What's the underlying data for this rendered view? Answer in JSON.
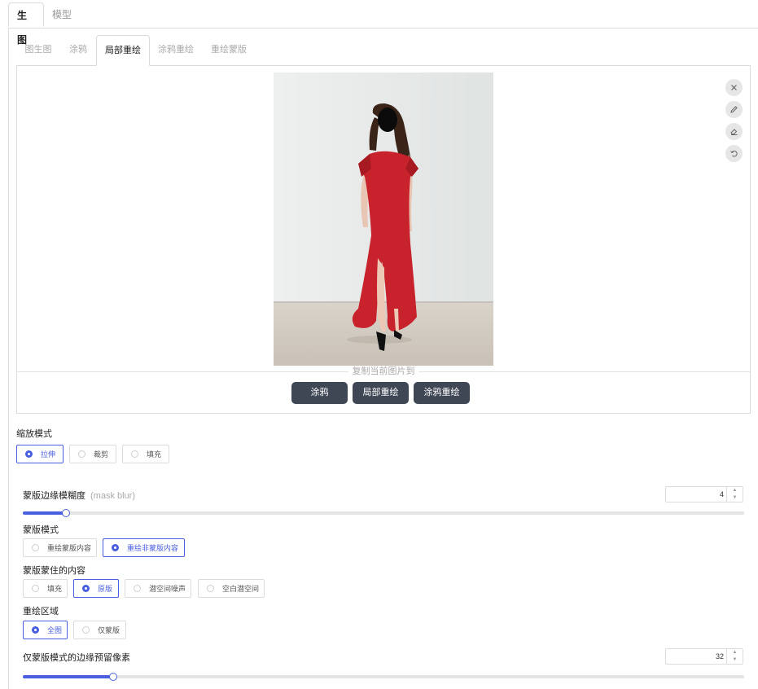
{
  "top_tabs": [
    "生图",
    "模型"
  ],
  "sub_tabs": [
    "图生图",
    "涂鸦",
    "局部重绘",
    "涂鸦重绘",
    "重绘蒙版"
  ],
  "image_tools": [
    "close-icon",
    "pencil-icon",
    "eraser-icon",
    "undo-icon"
  ],
  "copy_to": {
    "label": "复制当前图片到",
    "buttons": [
      "涂鸦",
      "局部重绘",
      "涂鸦重绘"
    ]
  },
  "resize_mode": {
    "title": "缩放模式",
    "options": [
      "拉伸",
      "裁剪",
      "填充"
    ],
    "selected": "拉伸"
  },
  "mask_blur": {
    "label": "蒙版边缘模糊度",
    "hint": "(mask blur)",
    "value": "4",
    "level": 0.06
  },
  "mask_mode": {
    "title": "蒙版模式",
    "options": [
      "重绘蒙版内容",
      "重绘非蒙版内容"
    ],
    "selected": "重绘非蒙版内容"
  },
  "masked_content": {
    "title": "蒙版蒙住的内容",
    "options": [
      "填充",
      "原版",
      "潜空间噪声",
      "空白潜空间"
    ],
    "selected": "原版"
  },
  "inpaint_area": {
    "title": "重绘区域",
    "options": [
      "全图",
      "仅蒙版"
    ],
    "selected": "全图"
  },
  "padding": {
    "label": "仅蒙版模式的边缘预留像素",
    "value": "32",
    "level": 0.125
  },
  "colors": {
    "accent": "#4a5fe0",
    "dark_button": "#3f4654",
    "dress": "#c8232c"
  }
}
